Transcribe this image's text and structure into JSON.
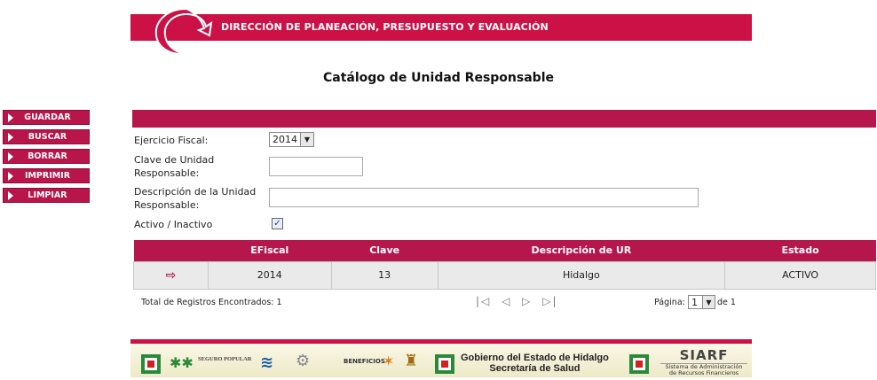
{
  "header": {
    "banner_title": "DIRECCIÓN DE PLANEACIÓN, PRESUPUESTO Y EVALUACIÓN",
    "brand_color": "#cc1146"
  },
  "page_title": "Catálogo de Unidad Responsable",
  "menu": {
    "items": [
      {
        "label": "GUARDAR"
      },
      {
        "label": "BUSCAR"
      },
      {
        "label": "BORRAR"
      },
      {
        "label": "IMPRIMIR"
      },
      {
        "label": "LIMPIAR"
      }
    ]
  },
  "form": {
    "ejercicio_label": "Ejercicio Fiscal:",
    "ejercicio_value": "2014",
    "clave_label_1": "Clave de Unidad",
    "clave_label_2": "Responsable:",
    "clave_value": "",
    "desc_label_1": "Descripción de la Unidad",
    "desc_label_2": "Responsable:",
    "desc_value": "",
    "activo_label": "Activo / Inactivo",
    "activo_checked": true
  },
  "table": {
    "headers": [
      "",
      "EFiscal",
      "Clave",
      "Descripción de UR",
      "Estado"
    ],
    "rows": [
      {
        "efiscal": "2014",
        "clave": "13",
        "descripcion": "Hidalgo",
        "estado": "ACTIVO"
      }
    ]
  },
  "pager": {
    "total_label": "Total de Registros Encontrados: 1",
    "page_label": "Página:",
    "page_value": "1",
    "of_label": "de 1"
  },
  "footer": {
    "gov_line1": "Gobierno del Estado de Hidalgo",
    "gov_line2": "Secretaría de Salud",
    "seguro_popular": "SEGURO POPULAR",
    "beneficios": "BENEFICIOS",
    "siarf_title": "SIARF",
    "siarf_sub1": "Sistema de Administración",
    "siarf_sub2": "de Recursos Financieros"
  }
}
